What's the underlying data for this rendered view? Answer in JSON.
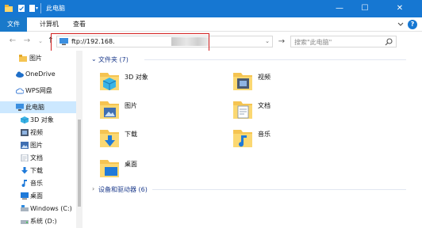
{
  "titlebar": {
    "title": "此电脑",
    "buttons": {
      "minimize": "—",
      "maximize": "☐",
      "close": "✕"
    }
  },
  "ribbon": {
    "tabs": [
      "文件",
      "计算机",
      "查看"
    ],
    "help": "?"
  },
  "address_bar": {
    "value": "ftp://192.168.",
    "search_placeholder": "搜索\"此电脑\""
  },
  "sidebar": {
    "items": [
      {
        "label": "图片",
        "icon": "folder-icon"
      },
      {
        "label": "OneDrive",
        "icon": "cloud-icon"
      },
      {
        "label": "WPS网盘",
        "icon": "cloud-outline-icon"
      },
      {
        "label": "此电脑",
        "icon": "computer-icon",
        "selected": true
      },
      {
        "label": "3D 对象",
        "icon": "cube-icon"
      },
      {
        "label": "视频",
        "icon": "video-icon"
      },
      {
        "label": "图片",
        "icon": "picture-icon"
      },
      {
        "label": "文档",
        "icon": "document-icon"
      },
      {
        "label": "下载",
        "icon": "download-icon"
      },
      {
        "label": "音乐",
        "icon": "music-icon"
      },
      {
        "label": "桌面",
        "icon": "desktop-icon"
      },
      {
        "label": "Windows (C:)",
        "icon": "drive-icon"
      },
      {
        "label": "系统 (D:)",
        "icon": "drive-icon"
      }
    ]
  },
  "content": {
    "folders_header": "文件夹 (7)",
    "folders": [
      {
        "label": "3D 对象",
        "icon": "cube-folder-icon"
      },
      {
        "label": "视频",
        "icon": "video-folder-icon"
      },
      {
        "label": "图片",
        "icon": "picture-folder-icon"
      },
      {
        "label": "文档",
        "icon": "document-folder-icon"
      },
      {
        "label": "下载",
        "icon": "download-folder-icon"
      },
      {
        "label": "音乐",
        "icon": "music-folder-icon"
      },
      {
        "label": "桌面",
        "icon": "desktop-folder-icon"
      }
    ],
    "devices_header": "设备和驱动器 (6)"
  },
  "colors": {
    "titlebar": "#1677d2",
    "accent": "#1979ca",
    "selection": "#cce8ff",
    "highlight_box": "#d21e1e",
    "folder": "#f5c452"
  }
}
